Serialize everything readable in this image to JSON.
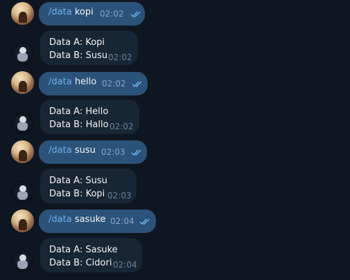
{
  "messages": [
    {
      "type": "out",
      "command": "/data",
      "text": "kopi",
      "time": "02:02"
    },
    {
      "type": "in",
      "line1": "Data A: Kopi",
      "line2": "Data B: Susu",
      "time": "02:02"
    },
    {
      "type": "out",
      "command": "/data",
      "text": "hello",
      "time": "02:02"
    },
    {
      "type": "in",
      "line1": "Data A: Hello",
      "line2": "Data B: Hallo",
      "time": "02:02"
    },
    {
      "type": "out",
      "command": "/data",
      "text": "susu",
      "time": "02:03"
    },
    {
      "type": "in",
      "line1": "Data A: Susu",
      "line2": "Data B: Kopi",
      "time": "02:03"
    },
    {
      "type": "out",
      "command": "/data",
      "text": "sasuke",
      "time": "02:04"
    },
    {
      "type": "in",
      "line1": "Data A: Sasuke",
      "line2": "Data B: Cidori",
      "time": "02:04"
    }
  ],
  "colors": {
    "background": "#0e1621",
    "outgoing_bubble": "#2b5278",
    "incoming_bubble": "#182533",
    "command_link": "#70b3ee"
  }
}
